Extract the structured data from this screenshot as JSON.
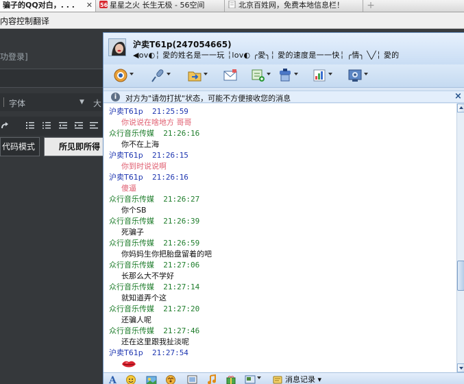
{
  "browser": {
    "tabs": [
      {
        "title": "骗子的QQ对白，. . .",
        "close": "✕"
      },
      {
        "title": "星星之火  长生无极 - 56空间"
      },
      {
        "title": "北京百姓网，免费本地信息栏！"
      }
    ],
    "new_tab": "+"
  },
  "editor": {
    "menu": [
      "内容控制",
      "翻译"
    ],
    "login_text": "功登录]",
    "font_label": "字体",
    "font_size_partial": "大",
    "source_mode": "代码模式",
    "wysiwyg_mode": "所见即所得"
  },
  "qq": {
    "contact_title": "沪卖T61p(247054665)",
    "signature_segments": [
      "◀ov◐",
      "愛的姓名是一一玩",
      "╎ⅼov◐",
      "╭愛╮",
      "愛的速度是一一快",
      "╭情╮",
      "╲╱",
      "愛的"
    ],
    "toolbar": [
      "video-call-icon",
      "voice-call-icon",
      "send-file-icon",
      "send-mail-icon",
      "create-discussion-icon",
      "apps-icon",
      "qq-show-icon",
      "settings-icon"
    ],
    "notice": "对方为\"请勿打扰\"状态，可能不方便接收您的消息",
    "notice_close": "×",
    "messages": [
      {
        "sender": "沪卖T61p",
        "time": "21:25:59",
        "text": "你说说在啥地方 哥哥",
        "side": "them"
      },
      {
        "sender": "众行音乐传媒",
        "time": "21:26:16",
        "text": "你不在上海",
        "side": "me"
      },
      {
        "sender": "沪卖T61p",
        "time": "21:26:15",
        "text": "你到时说说啊",
        "side": "them"
      },
      {
        "sender": "沪卖T61p",
        "time": "21:26:16",
        "text": "傻逼",
        "side": "them"
      },
      {
        "sender": "众行音乐传媒",
        "time": "21:26:27",
        "text": "你个SB",
        "side": "me"
      },
      {
        "sender": "众行音乐传媒",
        "time": "21:26:39",
        "text": "死骗子",
        "side": "me"
      },
      {
        "sender": "众行音乐传媒",
        "time": "21:26:59",
        "text": "你妈妈生你把胎盘留着的吧",
        "side": "me"
      },
      {
        "sender": "众行音乐传媒",
        "time": "21:27:06",
        "text": "长那么大不学好",
        "side": "me"
      },
      {
        "sender": "众行音乐传媒",
        "time": "21:27:14",
        "text": "就知道弄个这",
        "side": "me"
      },
      {
        "sender": "众行音乐传媒",
        "time": "21:27:20",
        "text": "还骗人呢",
        "side": "me"
      },
      {
        "sender": "众行音乐传媒",
        "time": "21:27:46",
        "text": "还在这里跟我扯淡呢",
        "side": "me"
      },
      {
        "sender": "沪卖T61p",
        "time": "21:27:54",
        "text": "",
        "emoticon": "lips-emoticon",
        "side": "them"
      }
    ],
    "bottom_bar": {
      "history_label": "消息记录",
      "history_dropdown": "▾"
    },
    "colors": {
      "them_name": "#1d35b0",
      "me_name": "#1d7c2a",
      "them_text": "#e06072",
      "me_text": "#111111"
    }
  }
}
